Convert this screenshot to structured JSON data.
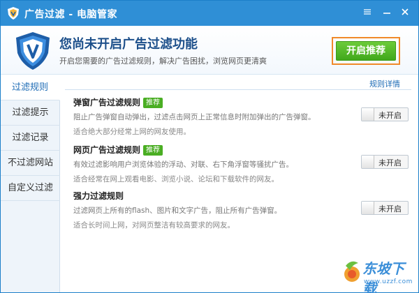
{
  "window": {
    "title": "广告过滤 - 电脑管家"
  },
  "banner": {
    "title": "您尚未开启广告过滤功能",
    "subtitle": "开启您需要的广告过滤规则，解决广告困扰，浏览网页更清爽",
    "enable_button": "开启推荐"
  },
  "sidebar": {
    "items": [
      {
        "label": "过滤规则",
        "active": true
      },
      {
        "label": "过滤提示"
      },
      {
        "label": "过滤记录"
      },
      {
        "label": "不过滤网站"
      },
      {
        "label": "自定义过滤"
      }
    ]
  },
  "main": {
    "rules_detail_link": "规则详情",
    "rules": [
      {
        "title": "弹窗广告过滤规则",
        "badge": "推荐",
        "desc": "阻止广告弹窗自动弹出，过滤点击网页上正常信息时附加弹出的广告弹窗。",
        "note": "适合绝大部分经常上网的网友使用。",
        "toggle": "未开启"
      },
      {
        "title": "网页广告过滤规则",
        "badge": "推荐",
        "desc": "有效过滤影响用户浏览体验的浮动、对联、右下角浮窗等骚扰广告。",
        "note": "适合经常在网上观看电影、浏览小说、论坛和下载软件的网友。",
        "toggle": "未开启"
      },
      {
        "title": "强力过滤规则",
        "badge": "",
        "desc": "过滤网页上所有的flash、图片和文字广告，阻止所有广告弹窗。",
        "note": "适合长时间上网，对网页整洁有较高要求的网友。",
        "toggle": "未开启"
      }
    ]
  },
  "watermark": {
    "text": "东坡下载",
    "url": "www.uzzf.com"
  },
  "colors": {
    "titlebar": "#2f8fd6",
    "accent_green": "#4aae23",
    "highlight_orange": "#f08a2a",
    "link_blue": "#1d6bb5"
  }
}
